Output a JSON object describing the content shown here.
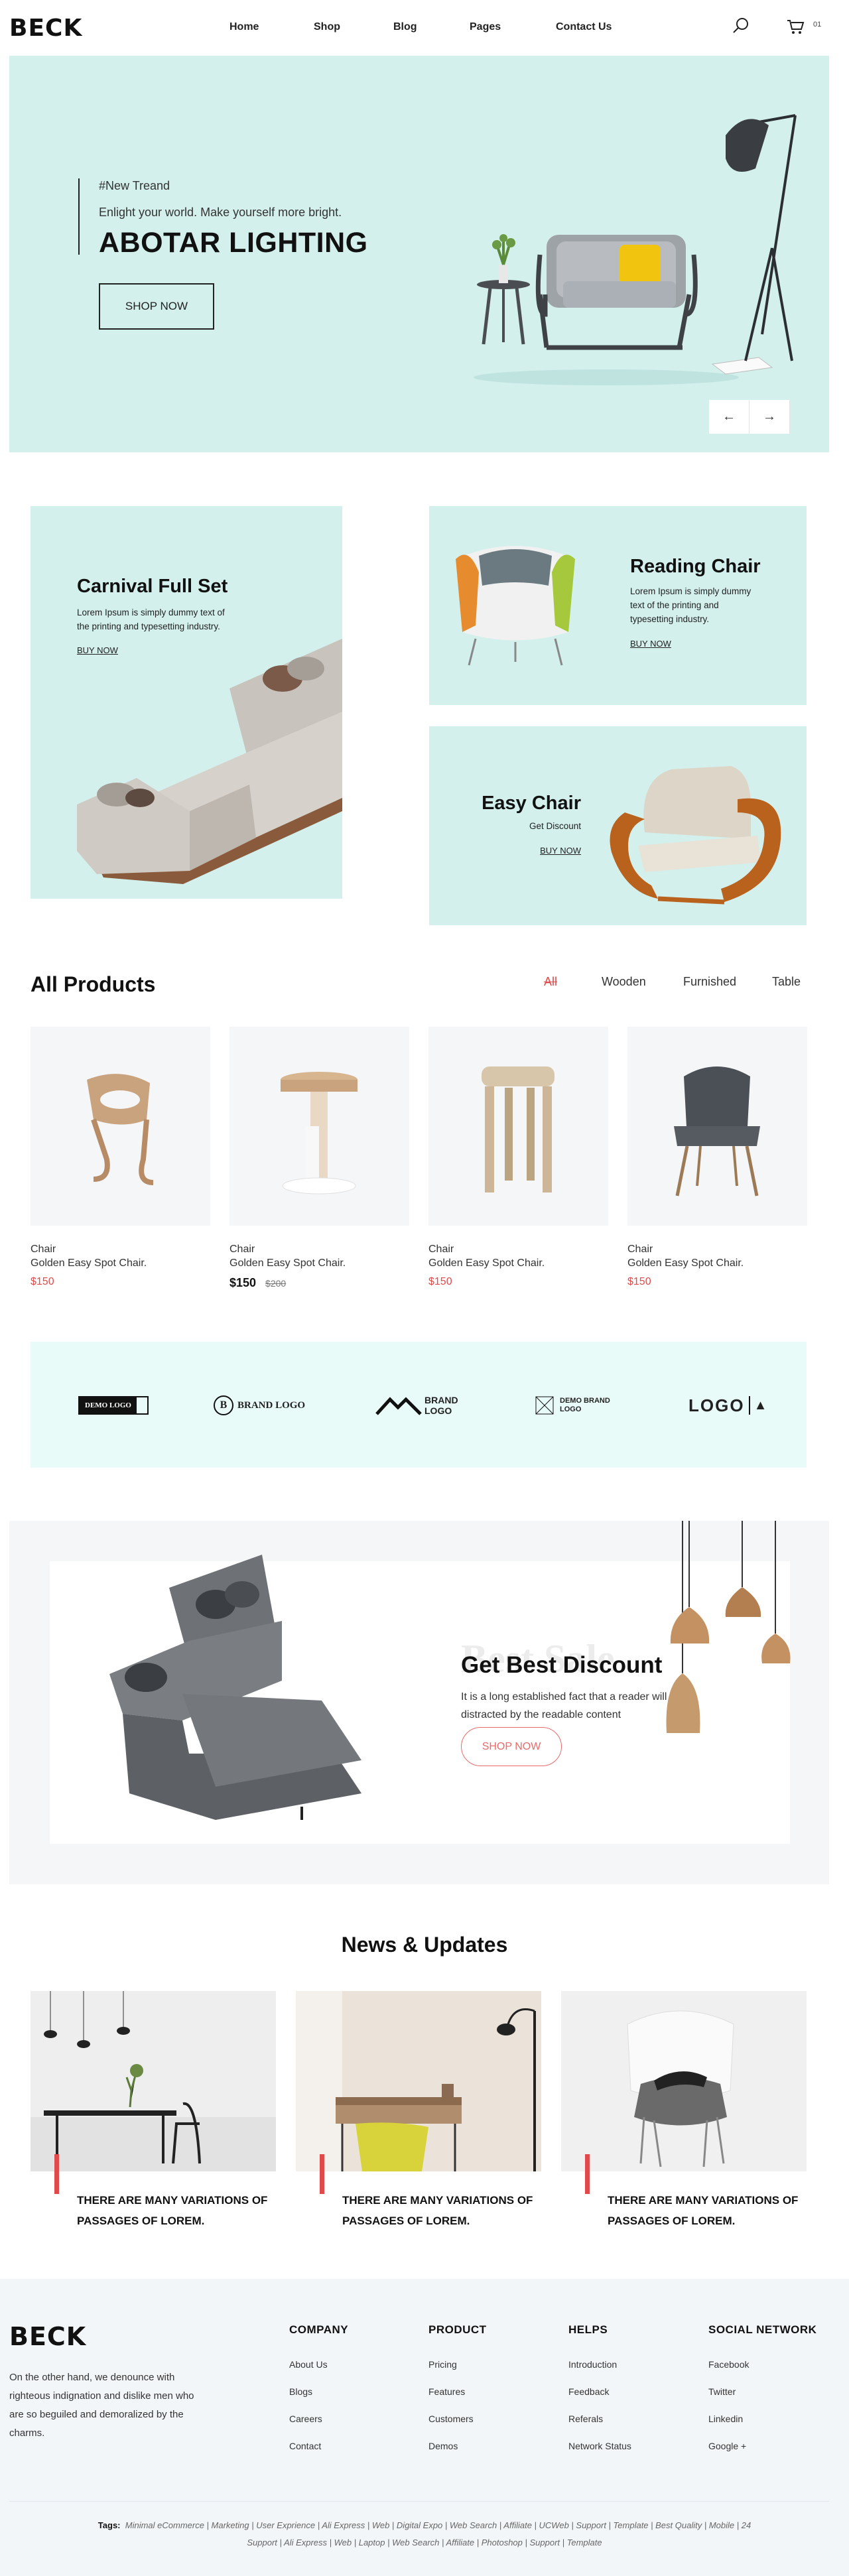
{
  "header": {
    "logo": "BECK",
    "nav": [
      "Home",
      "Shop",
      "Blog",
      "Pages",
      "Contact Us"
    ],
    "cart_count": "01",
    "icons": [
      "search-icon",
      "cart-icon"
    ]
  },
  "hero": {
    "tag": "#New Treand",
    "subtitle": "Enlight your world. Make yourself more bright.",
    "title": "ABOTAR LIGHTING",
    "button": "SHOP NOW",
    "arrows": [
      "arrow-left-icon",
      "arrow-right-icon"
    ]
  },
  "promos": {
    "carnival": {
      "title": "Carnival Full Set",
      "text": "Lorem Ipsum is simply dummy text of the printing and typesetting industry.",
      "link": "BUY NOW"
    },
    "reading": {
      "title": "Reading Chair",
      "text": "Lorem Ipsum is simply dummy text of the printing and typesetting industry.",
      "link": "BUY NOW"
    },
    "easy": {
      "title": "Easy Chair",
      "text": "Get Discount",
      "link": "BUY NOW"
    }
  },
  "products": {
    "title": "All Products",
    "filters": [
      "All",
      "Wooden",
      "Furnished",
      "Table"
    ],
    "items": [
      {
        "category": "Chair",
        "name": "Golden Easy Spot Chair.",
        "price": "$150",
        "old_price": ""
      },
      {
        "category": "Chair",
        "name": "Golden Easy Spot Chair.",
        "price": "$150",
        "old_price": "$200"
      },
      {
        "category": "Chair",
        "name": "Golden Easy Spot Chair.",
        "price": "$150",
        "old_price": ""
      },
      {
        "category": "Chair",
        "name": "Golden Easy Spot Chair.",
        "price": "$150",
        "old_price": ""
      }
    ]
  },
  "brands": [
    "DEMO LOGO",
    "BRAND LOGO",
    "BRAND LOGO",
    "DEMO BRAND LOGO",
    "LOGO"
  ],
  "sale": {
    "bg_text": "Best Sale",
    "title": "Get Best Discount",
    "text": "It is a long established fact that a reader will be distracted by the readable content",
    "button": "SHOP NOW"
  },
  "news": {
    "title": "News & Updates",
    "items": [
      {
        "title": "THERE ARE MANY VARIATIONS OF PASSAGES OF LOREM."
      },
      {
        "title": "THERE ARE MANY VARIATIONS OF PASSAGES OF LOREM."
      },
      {
        "title": "THERE ARE MANY VARIATIONS OF PASSAGES OF LOREM."
      }
    ]
  },
  "footer": {
    "logo": "BECK",
    "about": "On the other hand, we denounce with righteous indignation and dislike men who are so beguiled and demoralized by the charms.",
    "columns": [
      {
        "title": "COMPANY",
        "links": [
          "About Us",
          "Blogs",
          "Careers",
          "Contact"
        ]
      },
      {
        "title": "PRODUCT",
        "links": [
          "Pricing",
          "Features",
          "Customers",
          "Demos"
        ]
      },
      {
        "title": "HELPS",
        "links": [
          "Introduction",
          "Feedback",
          "Referals",
          "Network Status"
        ]
      },
      {
        "title": "SOCIAL NETWORK",
        "links": [
          "Facebook",
          "Twitter",
          "Linkedin",
          "Google +"
        ]
      }
    ],
    "tags_label": "Tags:",
    "tags_line1": "Minimal eCommerce | Marketing | User Exprience | Ali Express | Web | Digital Expo | Web Search | Affiliate | UCWeb | Support | Template | Best Quality | Mobile | 24",
    "tags_line2": "Support | Ali Express | Web | Laptop | Web Search | Affiliate | Photoshop | Support | Template"
  },
  "colors": {
    "mint": "#d3f0ed",
    "accent_red": "#e04a4a",
    "dark": "#111111"
  }
}
